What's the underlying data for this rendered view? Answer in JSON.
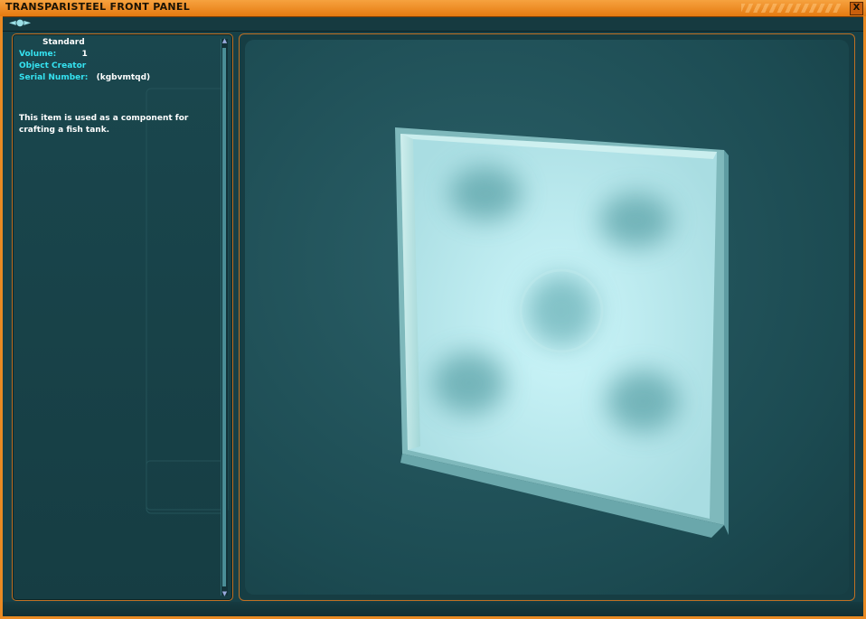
{
  "window": {
    "title": "TRANSPARISTEEL FRONT PANEL",
    "close_label": "X",
    "nav_arrows": "◄●►",
    "accent_color": "#e98a23"
  },
  "info": {
    "condition": "Standard",
    "volume_label": "Volume:",
    "volume_value": "1",
    "creator_label": "Object Creator",
    "serial_label": "Serial Number:",
    "serial_value": "(kgbvmtqd)",
    "description": "This item is used as a component for crafting a fish tank.",
    "label_color": "#35e2f0"
  },
  "viewer": {
    "object": "transparisteel-panel-model"
  }
}
